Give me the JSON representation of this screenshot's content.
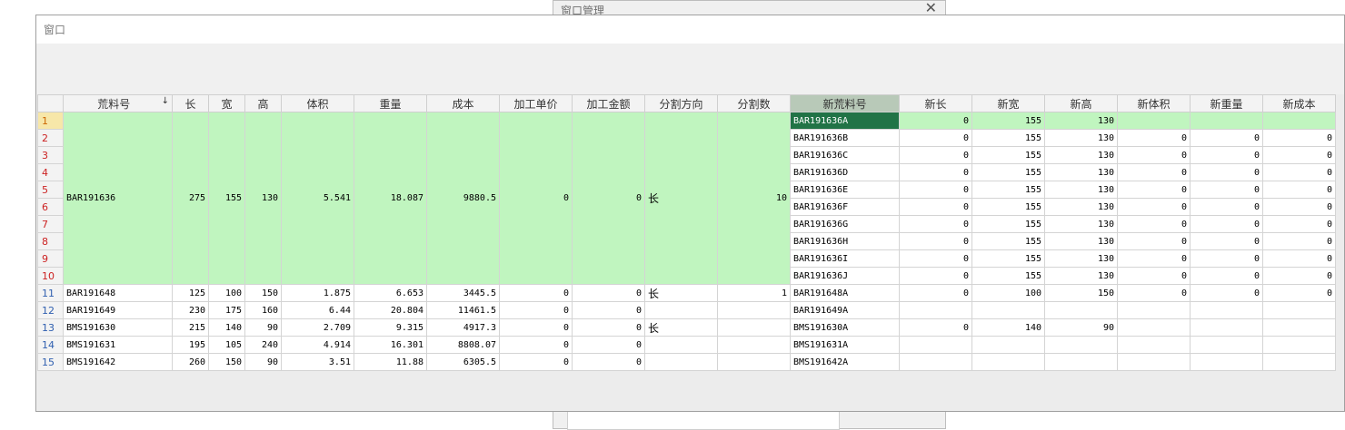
{
  "background_window": {
    "title": "窗口管理"
  },
  "window": {
    "title": "窗口"
  },
  "columns": [
    "",
    "荒料号",
    "长",
    "宽",
    "高",
    "体积",
    "重量",
    "成本",
    "加工单价",
    "加工金额",
    "分割方向",
    "分割数",
    "新荒料号",
    "新长",
    "新宽",
    "新高",
    "新体积",
    "新重量",
    "新成本"
  ],
  "merged_block": {
    "荒料号": "BAR191636",
    "长": "275",
    "宽": "155",
    "高": "130",
    "体积": "5.541",
    "重量": "18.087",
    "成本": "9880.5",
    "加工单价": "0",
    "加工金额": "0",
    "分割方向": "长",
    "分割数": "10"
  },
  "sub_rows": [
    {
      "rn": "1",
      "新荒料号": "BAR191636A",
      "新长": "0",
      "新宽": "155",
      "新高": "130",
      "新体积": "",
      "新重量": "",
      "新成本": ""
    },
    {
      "rn": "2",
      "新荒料号": "BAR191636B",
      "新长": "0",
      "新宽": "155",
      "新高": "130",
      "新体积": "0",
      "新重量": "0",
      "新成本": "0"
    },
    {
      "rn": "3",
      "新荒料号": "BAR191636C",
      "新长": "0",
      "新宽": "155",
      "新高": "130",
      "新体积": "0",
      "新重量": "0",
      "新成本": "0"
    },
    {
      "rn": "4",
      "新荒料号": "BAR191636D",
      "新长": "0",
      "新宽": "155",
      "新高": "130",
      "新体积": "0",
      "新重量": "0",
      "新成本": "0"
    },
    {
      "rn": "5",
      "新荒料号": "BAR191636E",
      "新长": "0",
      "新宽": "155",
      "新高": "130",
      "新体积": "0",
      "新重量": "0",
      "新成本": "0"
    },
    {
      "rn": "6",
      "新荒料号": "BAR191636F",
      "新长": "0",
      "新宽": "155",
      "新高": "130",
      "新体积": "0",
      "新重量": "0",
      "新成本": "0"
    },
    {
      "rn": "7",
      "新荒料号": "BAR191636G",
      "新长": "0",
      "新宽": "155",
      "新高": "130",
      "新体积": "0",
      "新重量": "0",
      "新成本": "0"
    },
    {
      "rn": "8",
      "新荒料号": "BAR191636H",
      "新长": "0",
      "新宽": "155",
      "新高": "130",
      "新体积": "0",
      "新重量": "0",
      "新成本": "0"
    },
    {
      "rn": "9",
      "新荒料号": "BAR191636I",
      "新长": "0",
      "新宽": "155",
      "新高": "130",
      "新体积": "0",
      "新重量": "0",
      "新成本": "0"
    },
    {
      "rn": "10",
      "新荒料号": "BAR191636J",
      "新长": "0",
      "新宽": "155",
      "新高": "130",
      "新体积": "0",
      "新重量": "0",
      "新成本": "0"
    }
  ],
  "rows": [
    {
      "rn": "11",
      "荒料号": "BAR191648",
      "长": "125",
      "宽": "100",
      "高": "150",
      "体积": "1.875",
      "重量": "6.653",
      "成本": "3445.5",
      "加工单价": "0",
      "加工金额": "0",
      "分割方向": "长",
      "分割数": "1",
      "新荒料号": "BAR191648A",
      "新长": "0",
      "新宽": "100",
      "新高": "150",
      "新体积": "0",
      "新重量": "0",
      "新成本": "0"
    },
    {
      "rn": "12",
      "荒料号": "BAR191649",
      "长": "230",
      "宽": "175",
      "高": "160",
      "体积": "6.44",
      "重量": "20.804",
      "成本": "11461.5",
      "加工单价": "0",
      "加工金额": "0",
      "分割方向": "",
      "分割数": "",
      "新荒料号": "BAR191649A",
      "新长": "",
      "新宽": "",
      "新高": "",
      "新体积": "",
      "新重量": "",
      "新成本": ""
    },
    {
      "rn": "13",
      "荒料号": "BMS191630",
      "长": "215",
      "宽": "140",
      "高": "90",
      "体积": "2.709",
      "重量": "9.315",
      "成本": "4917.3",
      "加工单价": "0",
      "加工金额": "0",
      "分割方向": "长",
      "分割数": "",
      "新荒料号": "BMS191630A",
      "新长": "0",
      "新宽": "140",
      "新高": "90",
      "新体积": "",
      "新重量": "",
      "新成本": ""
    },
    {
      "rn": "14",
      "荒料号": "BMS191631",
      "长": "195",
      "宽": "105",
      "高": "240",
      "体积": "4.914",
      "重量": "16.301",
      "成本": "8808.07",
      "加工单价": "0",
      "加工金额": "0",
      "分割方向": "",
      "分割数": "",
      "新荒料号": "BMS191631A",
      "新长": "",
      "新宽": "",
      "新高": "",
      "新体积": "",
      "新重量": "",
      "新成本": ""
    },
    {
      "rn": "15",
      "荒料号": "BMS191642",
      "长": "260",
      "宽": "150",
      "高": "90",
      "体积": "3.51",
      "重量": "11.88",
      "成本": "6305.5",
      "加工单价": "0",
      "加工金额": "0",
      "分割方向": "",
      "分割数": "",
      "新荒料号": "BMS191642A",
      "新长": "",
      "新宽": "",
      "新高": "",
      "新体积": "",
      "新重量": "",
      "新成本": ""
    }
  ],
  "icons": {
    "sort": "sort-down-icon",
    "close": "close-icon"
  },
  "colors": {
    "highlight": "#c0f5bf",
    "current_cell": "#217346",
    "selected_header": "#b8c9b8"
  }
}
